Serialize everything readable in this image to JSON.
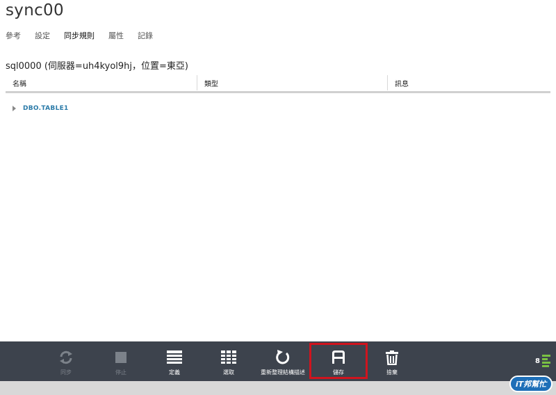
{
  "page": {
    "title": "sync00"
  },
  "tabs": [
    {
      "label": "參考"
    },
    {
      "label": "設定"
    },
    {
      "label": "同步規則",
      "active": true
    },
    {
      "label": "屬性"
    },
    {
      "label": "記錄"
    }
  ],
  "database": {
    "label": "sql0000 (伺服器=uh4kyol9hj，位置=東亞)"
  },
  "table": {
    "columns": [
      "名稱",
      "類型",
      "訊息"
    ],
    "rows": [
      {
        "name": "DBO.TABLE1"
      }
    ]
  },
  "commandbar": {
    "buttons": [
      {
        "label": "同步",
        "icon": "sync-icon",
        "enabled": false
      },
      {
        "label": "停止",
        "icon": "stop-icon",
        "enabled": false
      },
      {
        "label": "定義",
        "icon": "define-icon",
        "enabled": true
      },
      {
        "label": "選取",
        "icon": "select-grid-icon",
        "enabled": true
      },
      {
        "label": "重新整理結構描述",
        "icon": "refresh-icon",
        "enabled": true
      },
      {
        "label": "儲存",
        "icon": "save-icon",
        "enabled": true
      },
      {
        "label": "捨棄",
        "icon": "trash-icon",
        "enabled": true
      }
    ],
    "notification_count": "8"
  },
  "colors": {
    "commandbar_bg": "#3d434d",
    "accent_link": "#2a7aa8",
    "highlight": "#d0141e",
    "status_green": "#7ac143"
  },
  "watermark": {
    "text": "iT邦幫忙"
  }
}
